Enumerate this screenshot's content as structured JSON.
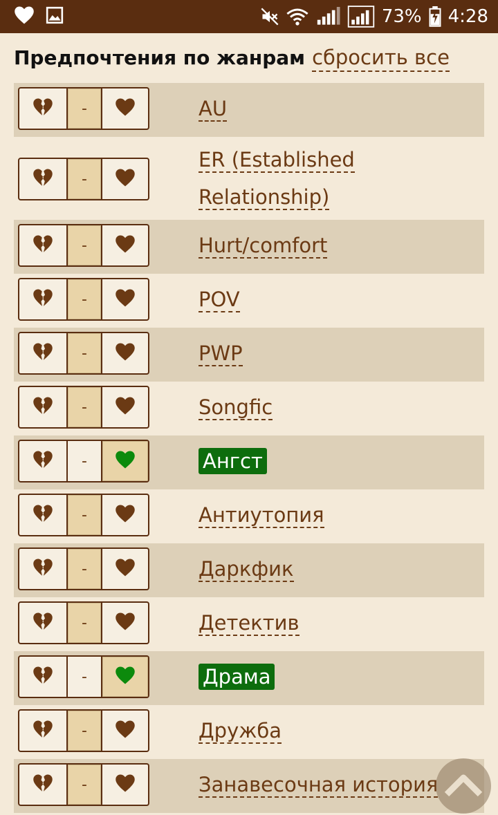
{
  "status_bar": {
    "battery": "73%",
    "time": "4:28",
    "icons": [
      "heart-icon",
      "image-icon",
      "mute-icon",
      "wifi-icon",
      "signal-icon",
      "signal-icon",
      "battery-charging-icon"
    ]
  },
  "header": {
    "title": "Предпочтения по жанрам",
    "reset_label": "сбросить все"
  },
  "rows": [
    {
      "label": "AU",
      "state": "neutral"
    },
    {
      "label": "ER (Established Relationship)",
      "label_line1": "ER (Established",
      "label_line2": "Relationship)",
      "state": "neutral"
    },
    {
      "label": "Hurt/comfort",
      "state": "neutral"
    },
    {
      "label": "POV",
      "state": "neutral"
    },
    {
      "label": "PWP",
      "state": "neutral"
    },
    {
      "label": "Songfic",
      "state": "neutral"
    },
    {
      "label": "Ангст",
      "state": "like"
    },
    {
      "label": "Антиутопия",
      "state": "neutral"
    },
    {
      "label": "Даркфик",
      "state": "neutral"
    },
    {
      "label": "Детектив",
      "state": "neutral"
    },
    {
      "label": "Драма",
      "state": "like"
    },
    {
      "label": "Дружба",
      "state": "neutral"
    },
    {
      "label": "Занавесочная история",
      "state": "neutral"
    }
  ],
  "segment_labels": {
    "neutral": "-"
  },
  "colors": {
    "status_bar": "#5a2d10",
    "background": "#f4ead9",
    "row_shade": "#ddd0b8",
    "accent_brown": "#6b3a14",
    "liked_green": "#0d6d0d",
    "liked_heart": "#0c8a0c",
    "active_segment": "#e9d4a8"
  }
}
